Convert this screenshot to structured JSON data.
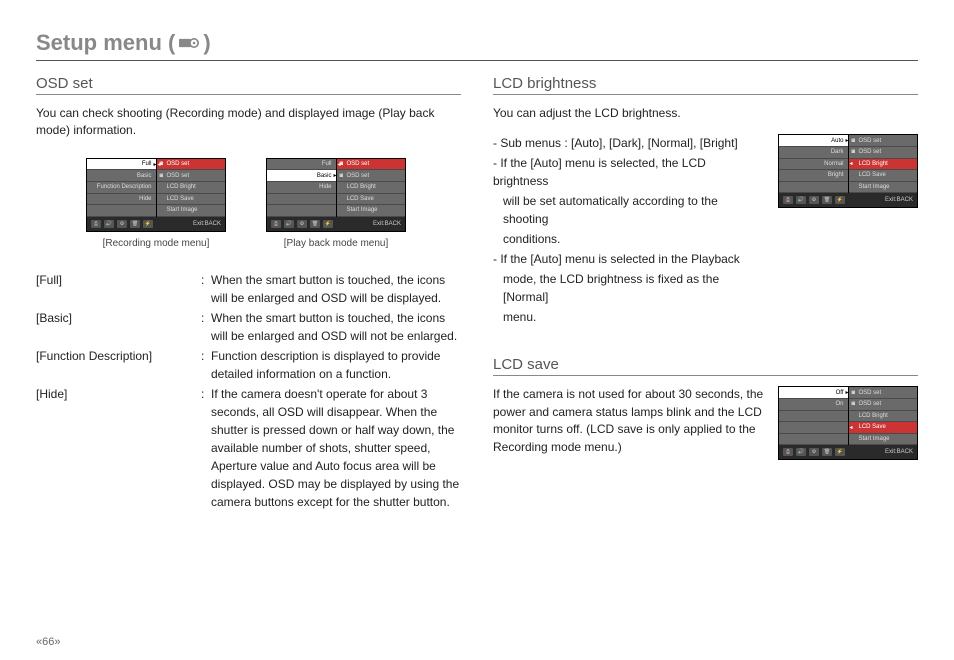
{
  "page": {
    "title_prefix": "Setup menu (",
    "title_suffix": ")",
    "number": "«66»"
  },
  "osd": {
    "title": "OSD set",
    "intro": "You can check shooting (Recording  mode) and displayed image (Play back mode) information.",
    "recording_caption": "[Recording mode menu]",
    "playback_caption": "[Play back mode menu]",
    "recording_menu": {
      "left": [
        "Full",
        "Basic",
        "Function Description",
        "Hide",
        ""
      ],
      "right": [
        "OSD set",
        "OSD set",
        "LCD Bright",
        "LCD Save",
        "Start Image"
      ],
      "selected_left_index": 0,
      "highlight_right_index": 0,
      "footer": "Exit:BACK"
    },
    "playback_menu": {
      "left": [
        "Full",
        "Basic",
        "Hide",
        "",
        ""
      ],
      "right": [
        "OSD set",
        "OSD set",
        "LCD Bright",
        "LCD Save",
        "Start Image"
      ],
      "selected_left_index": 1,
      "highlight_right_index": 0,
      "footer": "Exit:BACK"
    },
    "defs": [
      {
        "term": "[Full]",
        "desc": "When the smart button is touched, the icons will be enlarged and OSD will be displayed."
      },
      {
        "term": "[Basic]",
        "desc": "When the smart button is touched, the icons will be enlarged and OSD will not be enlarged."
      },
      {
        "term": "[Function Description]",
        "desc": "Function description is displayed to provide detailed information on a function."
      },
      {
        "term": "[Hide]",
        "desc": "If the camera doesn't operate for about 3 seconds, all OSD will disappear. When the shutter is pressed down or half way down, the available number of shots, shutter speed, Aperture value and Auto focus area will be displayed. OSD may be displayed by using the camera buttons except for the shutter button."
      }
    ]
  },
  "brightness": {
    "title": "LCD brightness",
    "intro": "You can adjust the LCD brightness.",
    "lines": [
      "- Sub menus : [Auto], [Dark], [Normal], [Bright]",
      "- If the [Auto] menu is selected, the LCD brightness",
      "will be set automatically according to the shooting",
      "conditions.",
      "- If the [Auto] menu is selected in the Playback",
      "mode, the LCD brightness is fixed as the [Normal]",
      "menu."
    ],
    "menu": {
      "left": [
        "Auto",
        "Dark",
        "Normal",
        "Bright",
        ""
      ],
      "right": [
        "OSD set",
        "OSD set",
        "LCD Bright",
        "LCD Save",
        "Start Image"
      ],
      "selected_left_index": 0,
      "highlight_right_index": 2,
      "footer": "Exit:BACK"
    }
  },
  "lcdsave": {
    "title": "LCD save",
    "intro": "If the camera is not used for about 30 seconds, the power and camera status lamps blink and the LCD monitor turns off. (LCD save is only applied to the Recording mode menu.)",
    "menu": {
      "left": [
        "Off",
        "On",
        "",
        "",
        ""
      ],
      "right": [
        "OSD set",
        "OSD set",
        "LCD Bright",
        "LCD Save",
        "Start Image"
      ],
      "selected_left_index": 0,
      "highlight_right_index": 3,
      "footer": "Exit:BACK"
    }
  }
}
